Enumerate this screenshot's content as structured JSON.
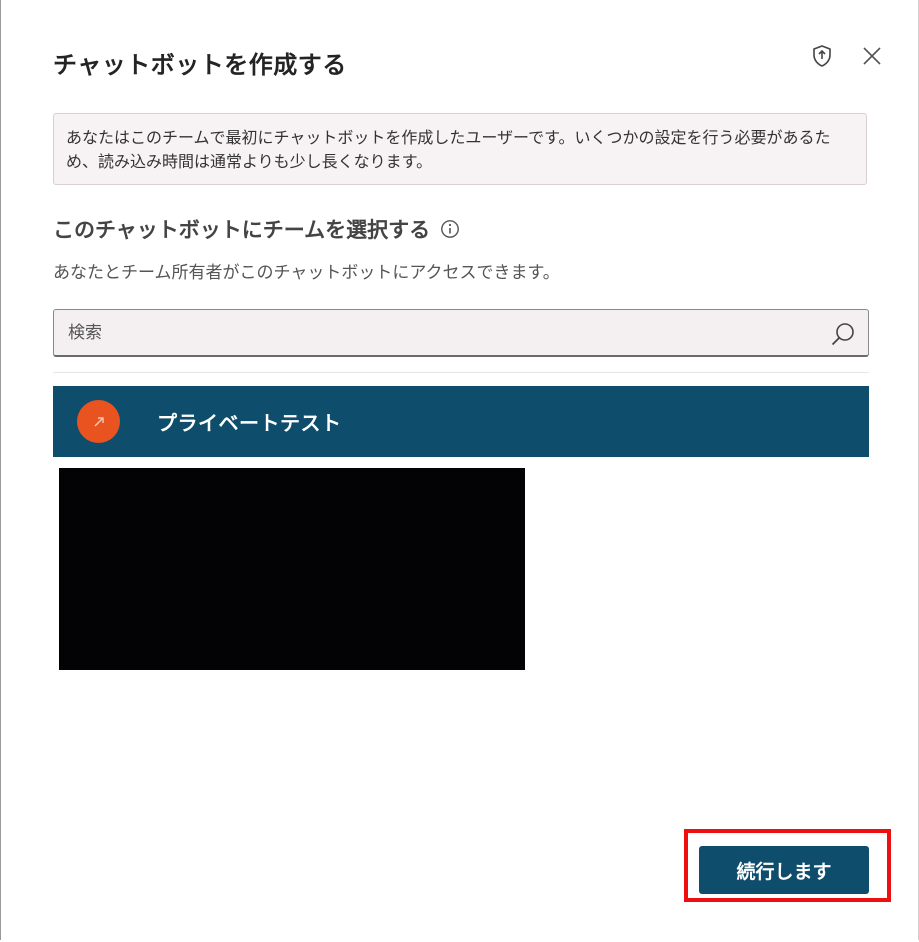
{
  "dialog": {
    "title": "チャットボットを作成する",
    "icons": {
      "shield": "shield-icon",
      "close": "close-icon"
    },
    "notice": "あなたはこのチームで最初にチャットボットを作成したユーザーです。いくつかの設定を行う必要があるため、読み込み時間は通常よりも少し長くなります。",
    "section_title": "このチャットボットにチームを選択する",
    "section_subtitle": "あなたとチーム所有者がこのチャットボットにアクセスできます。",
    "search": {
      "placeholder": "検索",
      "value": "",
      "icon": "search-icon"
    },
    "teams": [
      {
        "label": "プライベートテスト",
        "avatar_color": "#e9531f",
        "selected": true
      }
    ],
    "continue_label": "続行します"
  },
  "colors": {
    "accent": "#0e4d6b",
    "notice_bg": "#f7f2f3",
    "highlight": "#ee1010",
    "redaction": "#030204"
  }
}
